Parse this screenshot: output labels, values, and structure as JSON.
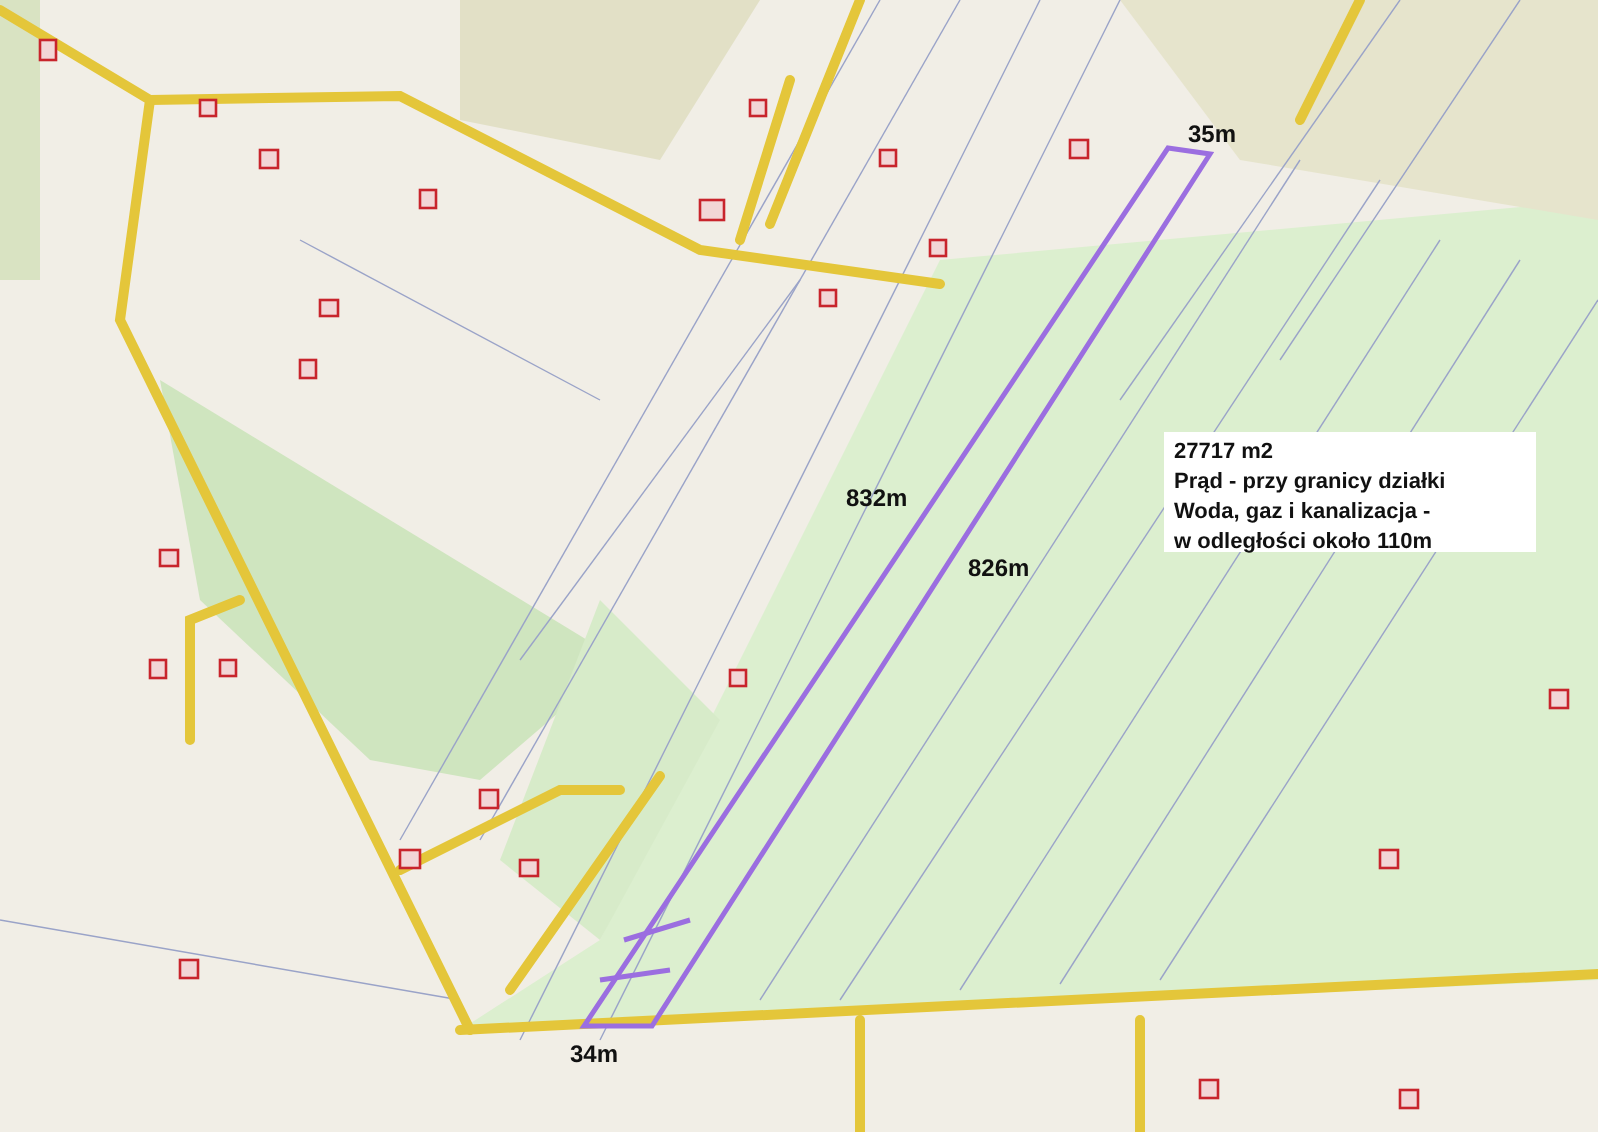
{
  "map": {
    "distance_labels": [
      "35m",
      "832m",
      "826m",
      "34m"
    ],
    "info_box": {
      "lines": [
        "27717 m2",
        "Prąd - przy granicy działki",
        "Woda, gaz i kanalizacja -",
        "w odległości około 110m"
      ]
    }
  }
}
